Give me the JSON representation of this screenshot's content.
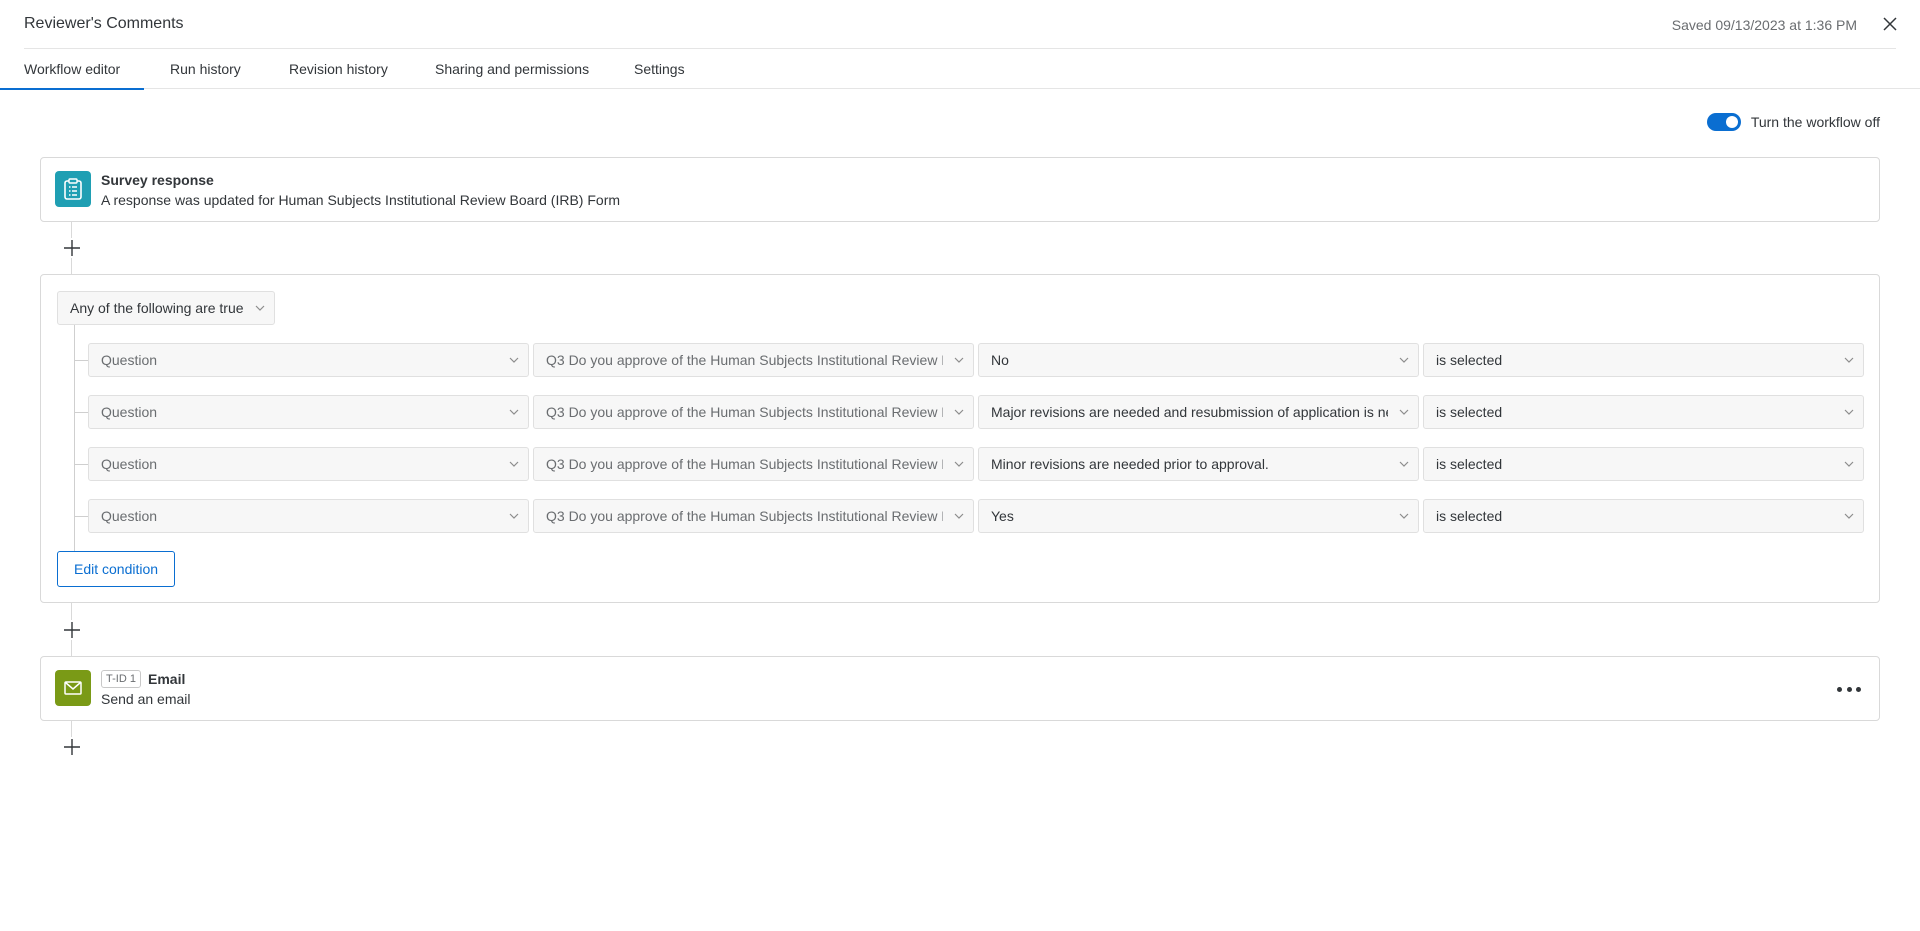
{
  "header": {
    "title": "Reviewer's Comments",
    "saved_text": "Saved 09/13/2023 at 1:36 PM"
  },
  "tabs": [
    {
      "label": "Workflow editor",
      "active": true
    },
    {
      "label": "Run history",
      "active": false
    },
    {
      "label": "Revision history",
      "active": false
    },
    {
      "label": "Sharing and permissions",
      "active": false
    },
    {
      "label": "Settings",
      "active": false
    }
  ],
  "toggle": {
    "label": "Turn the workflow off",
    "on": true
  },
  "trigger": {
    "icon": "clipboard-icon",
    "title": "Survey response",
    "subtitle": "A response was updated for Human Subjects Institutional Review Board (IRB) Form"
  },
  "condition": {
    "mode": "Any of the following are true",
    "rows": [
      {
        "type": "Question",
        "question": "Q3 Do you approve of the Human Subjects Institutional Review B",
        "answer": "No",
        "operator": "is selected"
      },
      {
        "type": "Question",
        "question": "Q3 Do you approve of the Human Subjects Institutional Review B",
        "answer": "Major revisions are needed and resubmission of application is ne",
        "operator": "is selected"
      },
      {
        "type": "Question",
        "question": "Q3 Do you approve of the Human Subjects Institutional Review B",
        "answer": "Minor revisions are needed prior to approval.",
        "operator": "is selected"
      },
      {
        "type": "Question",
        "question": "Q3 Do you approve of the Human Subjects Institutional Review B",
        "answer": "Yes",
        "operator": "is selected"
      }
    ],
    "edit_label": "Edit condition"
  },
  "task": {
    "icon": "envelope-icon",
    "badge": "T-ID 1",
    "title": "Email",
    "subtitle": "Send an email"
  },
  "colors": {
    "accent": "#0a6ed1",
    "trigger_icon_bg": "#1f9fb3",
    "email_icon_bg": "#7a9a16"
  }
}
